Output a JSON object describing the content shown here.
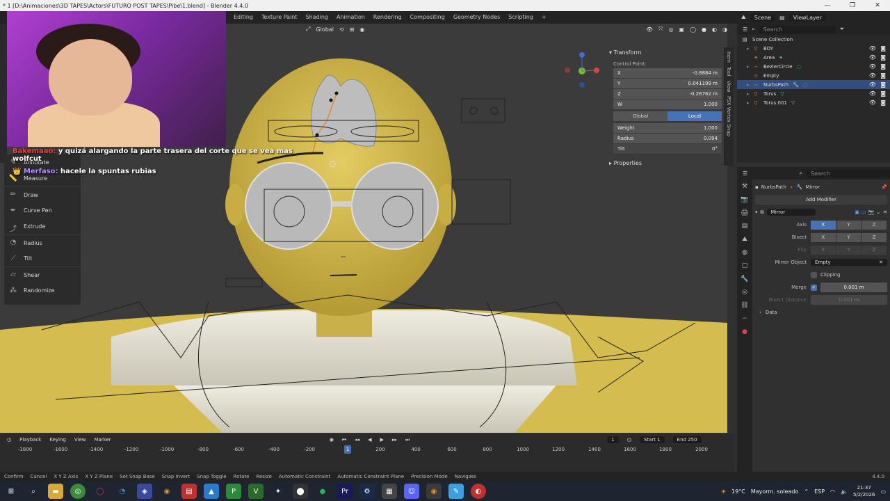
{
  "titlebar": {
    "title": "* 1 [D:\\Animaciones\\3D TAPES\\Actors\\FUTURO POST TAPES\\Pibe\\1.blend] - Blender 4.4.0",
    "min": "—",
    "max": "❐",
    "close": "✕"
  },
  "menubar": {
    "tabs": [
      "Editing",
      "Texture Paint",
      "Shading",
      "Animation",
      "Rendering",
      "Compositing",
      "Geometry Nodes",
      "Scripting",
      "+"
    ]
  },
  "scenebar": {
    "scene": "Scene",
    "view_layer": "ViewLayer"
  },
  "viewport_header": {
    "orientation": "Global"
  },
  "chat": {
    "line1_user": "Bakemaao:",
    "line1_text": "y quizá alargando la parte trasera del corte que se vea mas wolfcut",
    "line2_user": "Merfaso:",
    "line2_text": "hacele la spuntas rubias"
  },
  "tools": [
    {
      "label": "Annotate",
      "icon": "annotate-icon"
    },
    {
      "label": "Measure",
      "icon": "ruler-icon"
    },
    {
      "label": "Draw",
      "icon": "draw-icon"
    },
    {
      "label": "Curve Pen",
      "icon": "pen-icon"
    },
    {
      "label": "Extrude",
      "icon": "extrude-icon"
    },
    {
      "label": "Radius",
      "icon": "radius-icon"
    },
    {
      "label": "Tilt",
      "icon": "tilt-icon"
    },
    {
      "label": "Shear",
      "icon": "shear-icon"
    },
    {
      "label": "Randomize",
      "icon": "randomize-icon"
    }
  ],
  "npanel": {
    "transform_title": "Transform",
    "control_point_label": "Control Point:",
    "x_label": "X",
    "x_value": "-0.8884 m",
    "y_label": "Y",
    "y_value": "0.041199 m",
    "z_label": "Z",
    "z_value": "-0.26762 m",
    "w_label": "W",
    "w_value": "1.000",
    "global_label": "Global",
    "local_label": "Local",
    "weight_label": "Weight",
    "weight_value": "1.000",
    "radius_label": "Radius",
    "radius_value": "0.094",
    "tilt_label": "Tilt",
    "tilt_value": "0°",
    "properties_title": "Properties",
    "side_tabs": [
      "Item",
      "Tool",
      "View",
      "PSX Vertex Snap"
    ]
  },
  "outliner": {
    "search_placeholder": "Search",
    "root": "Scene Collection",
    "items": [
      {
        "name": "BOY",
        "selected": false
      },
      {
        "name": "Area",
        "selected": false
      },
      {
        "name": "BezierCircle",
        "selected": false
      },
      {
        "name": "Empty",
        "selected": false
      },
      {
        "name": "NurbsPath",
        "selected": true
      },
      {
        "name": "Torus",
        "selected": false
      },
      {
        "name": "Torus.001",
        "selected": false
      }
    ]
  },
  "properties": {
    "search_placeholder": "Search",
    "breadcrumb_object": "NurbsPath",
    "breadcrumb_modifier": "Mirror",
    "add_modifier": "Add Modifier",
    "modifier_name": "Mirror",
    "axis_label": "Axis",
    "bisect_label": "Bisect",
    "flip_label": "Flip",
    "axis_x": "X",
    "axis_y": "Y",
    "axis_z": "Z",
    "mirror_object_label": "Mirror Object",
    "mirror_object_value": "Empty",
    "clipping_label": "Clipping",
    "merge_label": "Merge",
    "merge_value": "0.001 m",
    "bisect_distance_label": "Bisect Distance",
    "bisect_distance_value": "0.001 m",
    "data_label": "Data"
  },
  "timeline": {
    "playback": "Playback",
    "keying": "Keying",
    "view": "View",
    "marker": "Marker",
    "current_frame": "1",
    "start_label": "Start",
    "start_value": "1",
    "end_label": "End",
    "end_value": "250",
    "ruler": [
      "-1800",
      "-1600",
      "-1400",
      "-1200",
      "-1000",
      "-800",
      "-600",
      "-400",
      "-200",
      "1",
      "200",
      "400",
      "600",
      "800",
      "1000",
      "1200",
      "1400",
      "1600",
      "1800",
      "2000"
    ]
  },
  "statusbar": {
    "items": [
      "Confirm",
      "Cancel",
      "X Y Z Axis",
      "X Y Z Plane",
      "Set Snap Base",
      "Snap Invert",
      "Snap Toggle",
      "Rotate",
      "Resize",
      "Automatic Constraint",
      "Automatic Constraint Plane",
      "Precision Mode",
      "Navigate"
    ],
    "version": "4.4.0"
  },
  "taskbar": {
    "weather_temp": "19°C",
    "weather_text": "Mayorm. soleado",
    "lang": "ESP",
    "time": "21:37",
    "date": "5/2/2026"
  },
  "colors": {
    "accent": "#4772b3",
    "skin": "#d8c25a",
    "shirt": "#e6e3d6"
  }
}
